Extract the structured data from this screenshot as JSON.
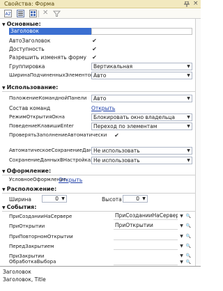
{
  "window": {
    "title": "Свойства: Форма"
  },
  "sections": {
    "basic": "Основные:",
    "usage": "Использование:",
    "design": "Оформление:",
    "layout": "Расположение:",
    "events": "События:"
  },
  "basic": {
    "title_label": "Заголовок",
    "autotitle_label": "АвтоЗаголовок",
    "availability_label": "Доступность",
    "allow_change_label": "Разрешить изменять форму",
    "grouping_label": "Группировка",
    "grouping_value": "Вертикальная",
    "child_width_label": "ШиринаПодчиненныхЭлементов",
    "child_width_value": "Авто"
  },
  "usage": {
    "cmdpanel_label": "ПоложениеКоманднойПанели",
    "cmdpanel_value": "Авто",
    "commands_label": "Состав команд",
    "commands_link": "Открыть",
    "window_mode_label": "РежимОткрытияОкна",
    "window_mode_value": "Блокировать окно владельца",
    "enter_label": "ПоведениеКлавишиEnter",
    "enter_value": "Переход по элементам",
    "autofill_label": "ПроверятьЗаполнениеАвтоматически",
    "autosave_label": "АвтоматическоеСохранениеДанныхВНас",
    "autosave_value": "Не использовать",
    "save_label": "СохранениеДанныхВНастройках",
    "save_value": "Не использовать"
  },
  "design": {
    "conditional_label": "УсловноеОформление",
    "conditional_link": "Открыть"
  },
  "layout": {
    "width_label": "Ширина",
    "width_value": "0",
    "height_label": "Высота",
    "height_value": "0"
  },
  "events": [
    {
      "label": "ПриСозданииНаСервере",
      "value": "ПриСозданииНаСервере"
    },
    {
      "label": "ПриОткрытии",
      "value": "ПриОткрытии"
    },
    {
      "label": "ПриПовторномОткрытии",
      "value": ""
    },
    {
      "label": "ПередЗакрытием",
      "value": ""
    },
    {
      "label": "ПриЗакрытии",
      "value": ""
    },
    {
      "label": "ОбработкаВыбора",
      "value": ""
    }
  ],
  "footer": {
    "line1": "Заголовок",
    "line2": "Заголовок, Title"
  },
  "icons": {
    "pin": "pin-icon",
    "close": "close-icon",
    "sort": "sort-alpha-icon",
    "group": "group-by-category-icon",
    "list": "list-view-icon",
    "clear": "clear-icon",
    "filter": "filter-icon"
  },
  "colors": {
    "titlebar": "#f2e9bf",
    "selection": "#3b6fd1",
    "link": "#1d3ea8"
  }
}
